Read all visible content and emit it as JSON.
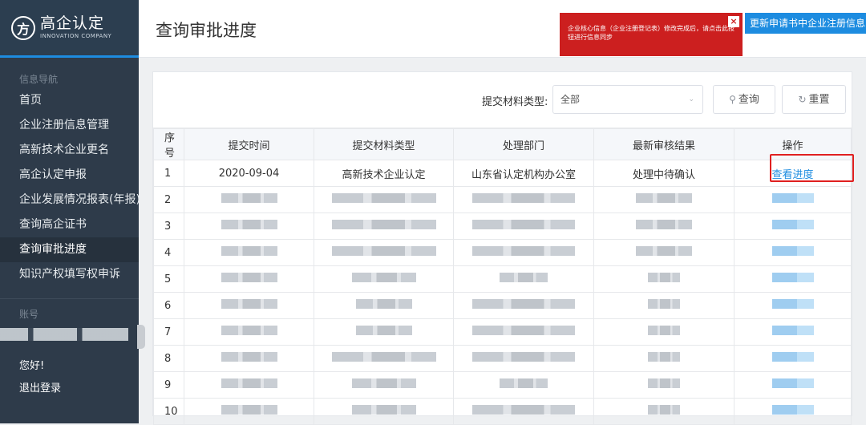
{
  "sidebar": {
    "logo_mark": "方",
    "logo_cn": "高企认定",
    "logo_en": "INNOVATION COMPANY",
    "nav_header": "信息导航",
    "items": [
      {
        "label": "首页"
      },
      {
        "label": "企业注册信息管理"
      },
      {
        "label": "高新技术企业更名"
      },
      {
        "label": "高企认定申报"
      },
      {
        "label": "企业发展情况报表(年报)"
      },
      {
        "label": "查询高企证书"
      },
      {
        "label": "查询审批进度",
        "active": true
      },
      {
        "label": "知识产权填写权申诉"
      }
    ],
    "account_header": "账号",
    "greeting": "您好!",
    "logout": "退出登录"
  },
  "header": {
    "title": "查询审批进度",
    "alert_text": "企业核心信息（企业注册登记表）修改完成后，请点击此按钮进行信息同步",
    "alert_close": "×",
    "sync_button": "更新申请书中企业注册信息"
  },
  "filter": {
    "label": "提交材料类型:",
    "select_value": "全部",
    "query_button": "查询",
    "reset_button": "重置"
  },
  "table": {
    "columns": [
      "序号",
      "提交时间",
      "提交材料类型",
      "处理部门",
      "最新审核结果",
      "操作"
    ],
    "first_row": {
      "idx": "1",
      "time": "2020-09-04",
      "type": "高新技术企业认定",
      "dept": "山东省认定机构办公室",
      "result": "处理中待确认",
      "action": "查看进度"
    },
    "row_indices": [
      "2",
      "3",
      "4",
      "5",
      "6",
      "7",
      "8",
      "9",
      "10"
    ]
  },
  "colors": {
    "accent": "#1d8ce0",
    "alert": "#cc1f1f",
    "sidebar": "#2e3b4a",
    "highlight_box": "#e02020"
  }
}
